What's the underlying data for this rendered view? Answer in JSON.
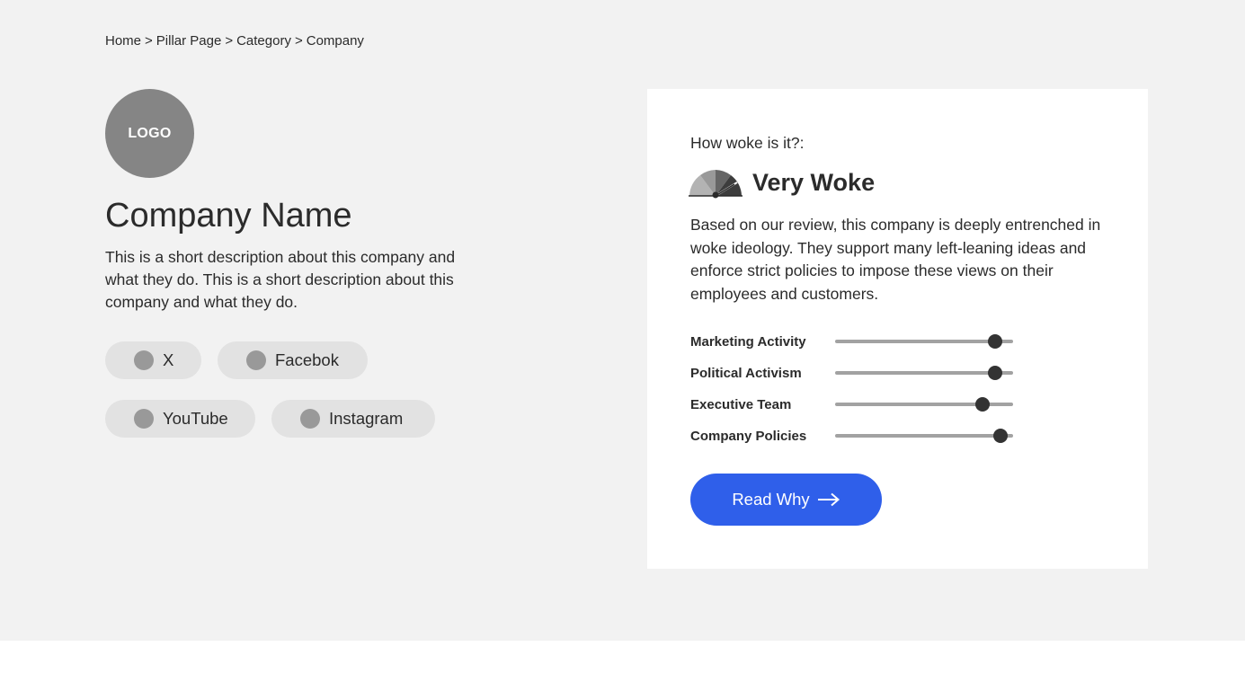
{
  "breadcrumb": {
    "items": [
      "Home",
      "Pillar Page",
      "Category",
      "Company"
    ],
    "separator": ">"
  },
  "company": {
    "logo_text": "LOGO",
    "name": "Company Name",
    "description": "This is a short description about this company and what they do. This is a short description about this company and what they do."
  },
  "socials": [
    {
      "label": "X",
      "icon": "x-icon"
    },
    {
      "label": "Facebok",
      "icon": "facebook-icon"
    },
    {
      "label": "YouTube",
      "icon": "youtube-icon"
    },
    {
      "label": "Instagram",
      "icon": "instagram-icon"
    }
  ],
  "rating": {
    "question": "How woke is it?:",
    "title": "Very Woke",
    "gauge_icon": "gauge-icon",
    "description": "Based on our review, this company is deeply entrenched in woke ideology. They support many left-leaning ideas and enforce strict policies to impose these views on their employees and customers."
  },
  "metrics": [
    {
      "label": "Marketing Activity",
      "level": 0.9
    },
    {
      "label": "Political Activism",
      "level": 0.9
    },
    {
      "label": "Executive Team",
      "level": 0.83
    },
    {
      "label": "Company Policies",
      "level": 0.93
    }
  ],
  "cta": {
    "label": "Read Why",
    "icon": "arrow-right-icon"
  },
  "colors": {
    "page_background": "#f2f2f2",
    "card_background": "#ffffff",
    "accent": "#2f5fea",
    "logo": "#858585",
    "pill": "#e2e2e2"
  }
}
